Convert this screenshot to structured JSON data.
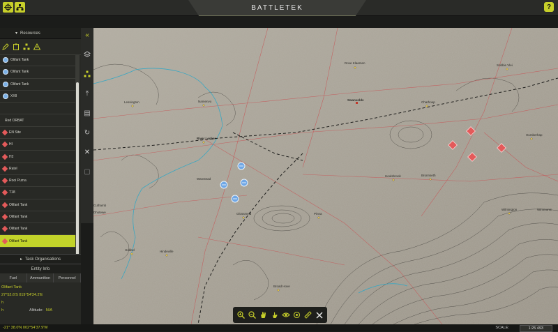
{
  "app": {
    "title": "BATTLETEK",
    "help_label": "?"
  },
  "resources": {
    "header": "Resources",
    "items": [
      {
        "label": "Olifant Tank",
        "icon": "blue-unit-icon"
      },
      {
        "label": "Olifant Tank",
        "icon": "blue-unit-icon"
      },
      {
        "label": "Olifant Tank",
        "icon": "blue-unit-icon"
      },
      {
        "label": "XXII",
        "icon": "blue-unit-icon"
      },
      {
        "label": "",
        "icon": "none"
      },
      {
        "label": "Red ORBAT",
        "icon": "none"
      },
      {
        "label": "EN Site",
        "icon": "red-unit-icon"
      },
      {
        "label": "HI",
        "icon": "red-unit-icon"
      },
      {
        "label": "H2",
        "icon": "red-unit-icon"
      },
      {
        "label": "Ratel",
        "icon": "red-unit-icon"
      },
      {
        "label": "Rooi Puma",
        "icon": "red-unit-icon"
      },
      {
        "label": "T18",
        "icon": "red-unit-icon"
      },
      {
        "label": "Olifant Tank",
        "icon": "red-unit-icon"
      },
      {
        "label": "Olifant Tank",
        "icon": "red-unit-icon"
      },
      {
        "label": "Olifant Tank",
        "icon": "red-unit-icon"
      },
      {
        "label": "Olifant Tank",
        "icon": "red-unit-icon",
        "selected": true
      },
      {
        "label": "",
        "icon": "none"
      }
    ]
  },
  "task_organisations": {
    "label": "Task Organisations"
  },
  "entity_info": {
    "header": "Entity Info",
    "tabs": [
      "Fuel",
      "Ammunition",
      "Personnel"
    ],
    "name": "Olifant Tank",
    "coords": "27°52.6'S 019°54'34.2'E",
    "altitude_label": "Altitude:",
    "altitude_value": "N/A",
    "row1_prefix": "h",
    "row2_prefix": "h"
  },
  "status": {
    "cursor": "-21° 38.0'N 002°54'37.9'W",
    "scale_label": "SCALE:",
    "scale_value": "1:25 493"
  },
  "map": {
    "places": [
      "Dove Klaamen",
      "Sobbie Vlei",
      "Lessington",
      "Namenvo",
      "Swanvolds",
      "Charhoep",
      "River Lecher",
      "Wanstead",
      "Heulsbrook",
      "Bronnseth",
      "Wilmington",
      "Dhotewe",
      "Pinna",
      "Glossmeld",
      "Hokbel",
      "Wimmonic",
      "Hindeville",
      "Cuthamb",
      "Broad Hove",
      "Humberhap"
    ],
    "colors": {
      "terrain": "#a7a195",
      "roads": "#c45c5c",
      "rivers": "#3aa7c2",
      "contours": "#3c3a36",
      "friendly": "#6fa7e6",
      "hostile": "#e35a5a",
      "accent": "#c2d32a"
    }
  }
}
